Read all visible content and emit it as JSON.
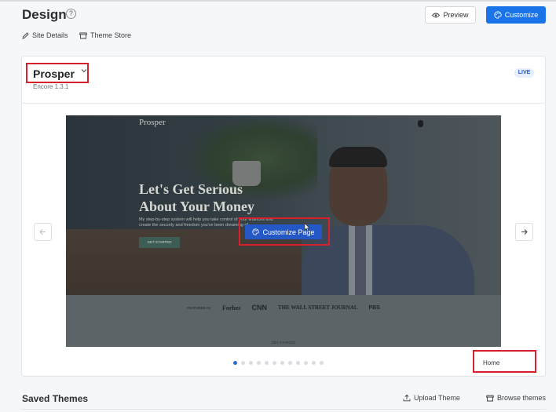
{
  "header": {
    "title": "Design",
    "help_icon": "question-circle-icon",
    "preview_label": "Preview",
    "customize_label": "Customize"
  },
  "sublinks": {
    "site_details": "Site Details",
    "theme_store": "Theme Store"
  },
  "theme": {
    "name": "Prosper",
    "version": "Encore 1.3.1",
    "status_badge": "LIVE"
  },
  "preview": {
    "brand": "Prosper",
    "headline_line1": "Let's Get Serious",
    "headline_line2": "About Your Money",
    "body_copy": "My step-by-step system will help you take control of your finances and create the security and freedom you've been dreaming of.",
    "cta_label": "GET STARTED",
    "customize_page_label": "Customize Page",
    "featured_label": "FEATURED IN:",
    "featured_logos": [
      "Forbes",
      "CNN",
      "THE WALL STREET JOURNAL",
      "PBS"
    ],
    "bottom_label": "GET STARTED"
  },
  "carousel": {
    "total_pages": 12,
    "active_index": 0,
    "page_label": "Home"
  },
  "saved_themes": {
    "title": "Saved Themes",
    "upload_label": "Upload Theme",
    "browse_label": "Browse themes"
  },
  "colors": {
    "primary": "#1a73e8",
    "highlight": "#d6202c",
    "live_badge_bg": "#e7efff",
    "live_badge_text": "#2358c7"
  }
}
